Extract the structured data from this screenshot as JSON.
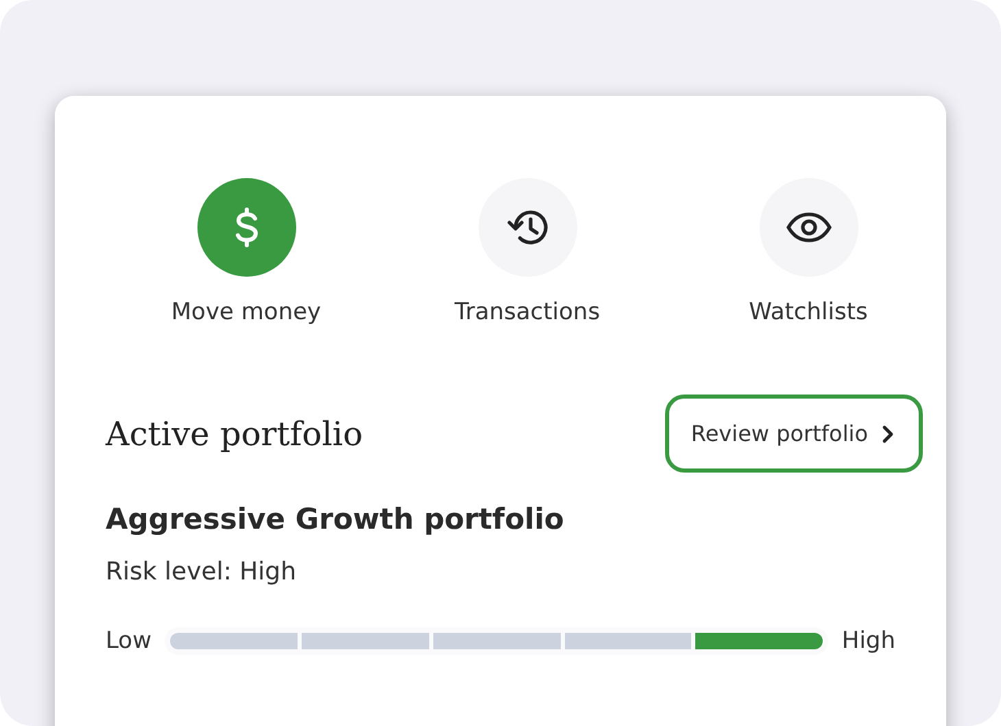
{
  "actions": [
    {
      "label": "Move money",
      "kind": "dollar",
      "selected": true
    },
    {
      "label": "Transactions",
      "kind": "history",
      "selected": false
    },
    {
      "label": "Watchlists",
      "kind": "eye",
      "selected": false
    }
  ],
  "portfolio": {
    "heading": "Active portfolio",
    "review_button": {
      "label": "Review portfolio",
      "focused": true
    },
    "name": "Aggressive Growth portfolio",
    "risk_text": "Risk level: High",
    "risk_meter": {
      "low_label": "Low",
      "high_label": "High",
      "segments": [
        {
          "selected": false
        },
        {
          "selected": false
        },
        {
          "selected": false
        },
        {
          "selected": false
        },
        {
          "selected": true
        }
      ]
    }
  }
}
